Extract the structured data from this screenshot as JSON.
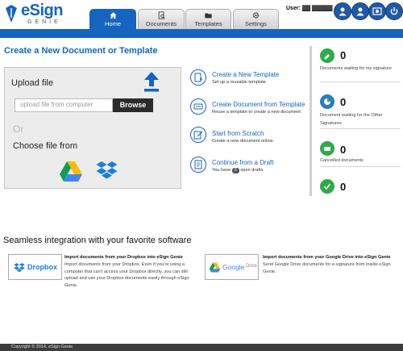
{
  "header": {
    "logo_main": "eSign",
    "logo_sub": "GENIE",
    "user_label": "User: ▓▓ ▓▓▓▓▓",
    "tabs": [
      {
        "label": "Home",
        "icon": "home-icon",
        "active": true
      },
      {
        "label": "Documents",
        "icon": "search-document-icon",
        "active": false
      },
      {
        "label": "Templates",
        "icon": "folder-icon",
        "active": false
      },
      {
        "label": "Settings",
        "icon": "gear-icon",
        "active": false
      }
    ],
    "action_icons": [
      "account-icon",
      "user-icon",
      "edit-icon",
      "image-icon",
      "power-icon"
    ]
  },
  "main": {
    "title": "Create a New Document or Template",
    "upload": {
      "title": "Upload file",
      "placeholder": "upload file from computer",
      "browse_label": "Browse",
      "or_label": "Or",
      "choose_label": "Choose file from"
    },
    "actions": [
      {
        "title": "Create a New Template",
        "desc": "Set up a reusable template"
      },
      {
        "title": "Create Document from Template",
        "desc": "Reuse a template to create a new document"
      },
      {
        "title": "Start from Scratch",
        "desc": "Create a new document online"
      },
      {
        "title": "Continue from a Draft",
        "desc_prefix": "You have",
        "drafts_count": "0",
        "desc_suffix": "open drafts."
      }
    ],
    "stats": [
      {
        "count": "0",
        "label": "Documents waiting for my signature"
      },
      {
        "count": "0",
        "label": "Document waiting for the Other Signatures"
      },
      {
        "count": "0",
        "label": "Cancelled documents"
      },
      {
        "count": "0",
        "label": ""
      }
    ]
  },
  "integration": {
    "title": "Seamless integration with your favorite software",
    "dropbox": {
      "logo_text": "Dropbox",
      "heading": "Import documents from your Dropbox into eSign Genie",
      "desc": "Import documents from your Dropbox. Even if you're using a computer that can't access your Dropbox directly, you can still upload and use your Dropbox documents easily through eSign Genie."
    },
    "gdrive": {
      "logo_text": "Google",
      "logo_text_2": "Drive",
      "heading": "Import documents from your Google Drive into eSign Genie",
      "desc": "Send Google Drive documents for e-signature from inside eSign Genie."
    }
  },
  "footer": {
    "copyright": "Copyright © 2014, eSign Genie"
  },
  "colors": {
    "brand_blue": "#1565c0",
    "stat_green": "#2eab48",
    "footer_bg": "#3d3d3d"
  }
}
